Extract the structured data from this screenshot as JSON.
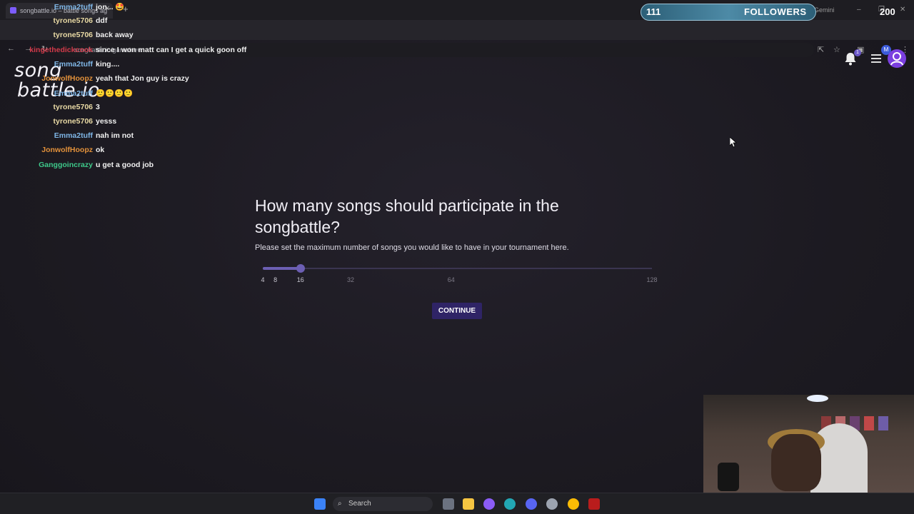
{
  "browser": {
    "tab_title": "songbattle.io – battle songs ag",
    "url": "songbattle.io/game/new",
    "gemini_label": "Gemini",
    "profile_initial": "M"
  },
  "followers_overlay": {
    "count": "111",
    "label": "FOLLOWERS",
    "goal": "200"
  },
  "site": {
    "logo_line1": "song",
    "logo_line2": "battle.io",
    "notification_count": "1"
  },
  "chat": [
    {
      "user": "Emma2tuff",
      "message": "jon... 🤩",
      "color": "#7fb6e6"
    },
    {
      "user": "tyrone5706",
      "message": "ddf",
      "color": "#e8d9a4"
    },
    {
      "user": "tyrone5706",
      "message": "back away",
      "color": "#e8d9a4"
    },
    {
      "user": "kingethedickcook",
      "message": "since I won matt can I get a quick goon off",
      "color": "#d23a4a"
    },
    {
      "user": "Emma2tuff",
      "message": "king....",
      "color": "#7fb6e6"
    },
    {
      "user": "JonwolfHoopz",
      "message": "yeah that Jon guy is crazy",
      "color": "#e2913a"
    },
    {
      "user": "Emma2tuff",
      "message": "🙂🙂🙂🙂",
      "color": "#7fb6e6"
    },
    {
      "user": "tyrone5706",
      "message": "3",
      "color": "#e8d9a4"
    },
    {
      "user": "tyrone5706",
      "message": "yesss",
      "color": "#e8d9a4"
    },
    {
      "user": "Emma2tuff",
      "message": "nah im not",
      "color": "#7fb6e6"
    },
    {
      "user": "JonwolfHoopz",
      "message": "ok",
      "color": "#e2913a"
    },
    {
      "user": "Ganggoincrazy",
      "message": "u get a good job",
      "color": "#3ec98a"
    }
  ],
  "main": {
    "heading": "How many songs should participate in the songbattle?",
    "subtext": "Please set the maximum number of songs you would like to have in your tournament here.",
    "slider": {
      "value": 16,
      "min": 4,
      "max": 128,
      "ticks": [
        "4",
        "8",
        "16",
        "32",
        "64",
        "128"
      ]
    },
    "continue_label": "CONTINUE"
  },
  "taskbar": {
    "search_label": "Search"
  },
  "colors": {
    "accent": "#6c5fb3",
    "button": "#2f2466",
    "background": "#1d1b23"
  }
}
